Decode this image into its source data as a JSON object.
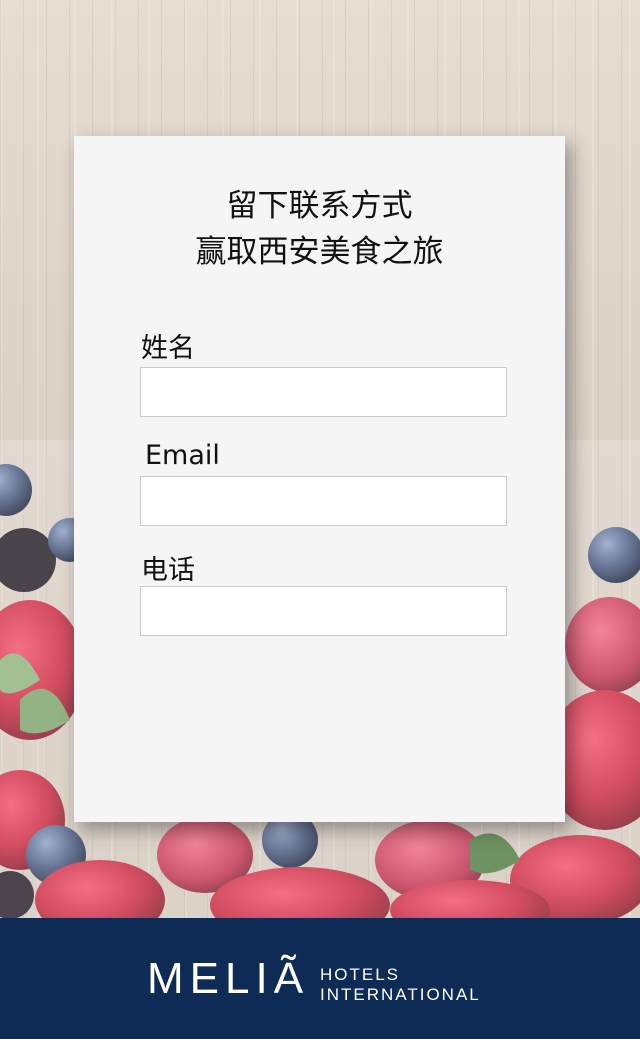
{
  "form": {
    "title_line1": "留下联系方式",
    "title_line2": "赢取西安美食之旅",
    "fields": [
      {
        "label": "姓名",
        "value": "",
        "placeholder": ""
      },
      {
        "label": "Email",
        "value": "",
        "placeholder": ""
      },
      {
        "label": "电话",
        "value": "",
        "placeholder": ""
      }
    ]
  },
  "footer": {
    "brand": "MELIÃ",
    "sub_line1": "HOTELS",
    "sub_line2": "INTERNATIONAL",
    "background_color": "#0d2b55"
  },
  "background": {
    "image": "berries-on-wood"
  }
}
